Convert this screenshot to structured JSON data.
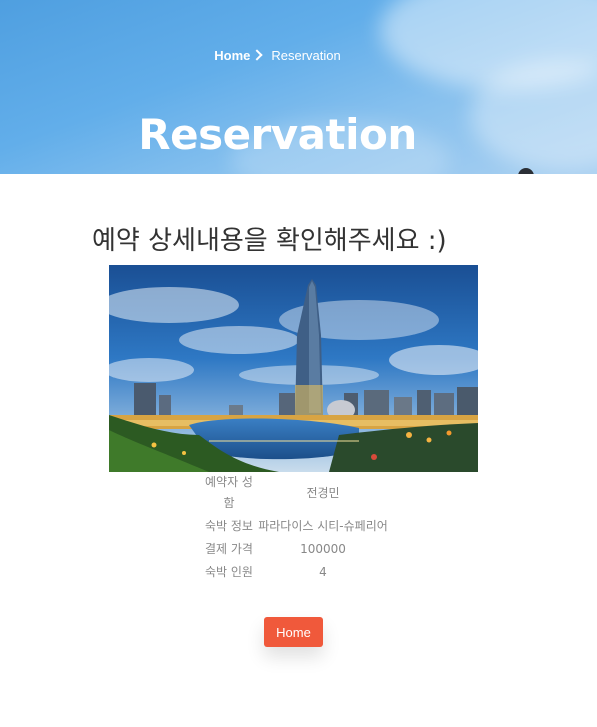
{
  "hero": {
    "breadcrumb_home": "Home",
    "breadcrumb_current": "Reservation",
    "title": "Reservation"
  },
  "main": {
    "headline": "예약 상세내용을 확인해주세요 :)",
    "details": [
      {
        "label": "예약자 성함",
        "value": "전경민"
      },
      {
        "label": "숙박 정보",
        "value": "파라다이스 시티-슈페리어"
      },
      {
        "label": "결제 가격",
        "value": "100000"
      },
      {
        "label": "숙박 인원",
        "value": "4"
      }
    ],
    "home_button": "Home"
  },
  "colors": {
    "hero_sky": "#5aa8e6",
    "button": "#f0593b",
    "headline": "#333333",
    "detail_text": "#888888"
  }
}
